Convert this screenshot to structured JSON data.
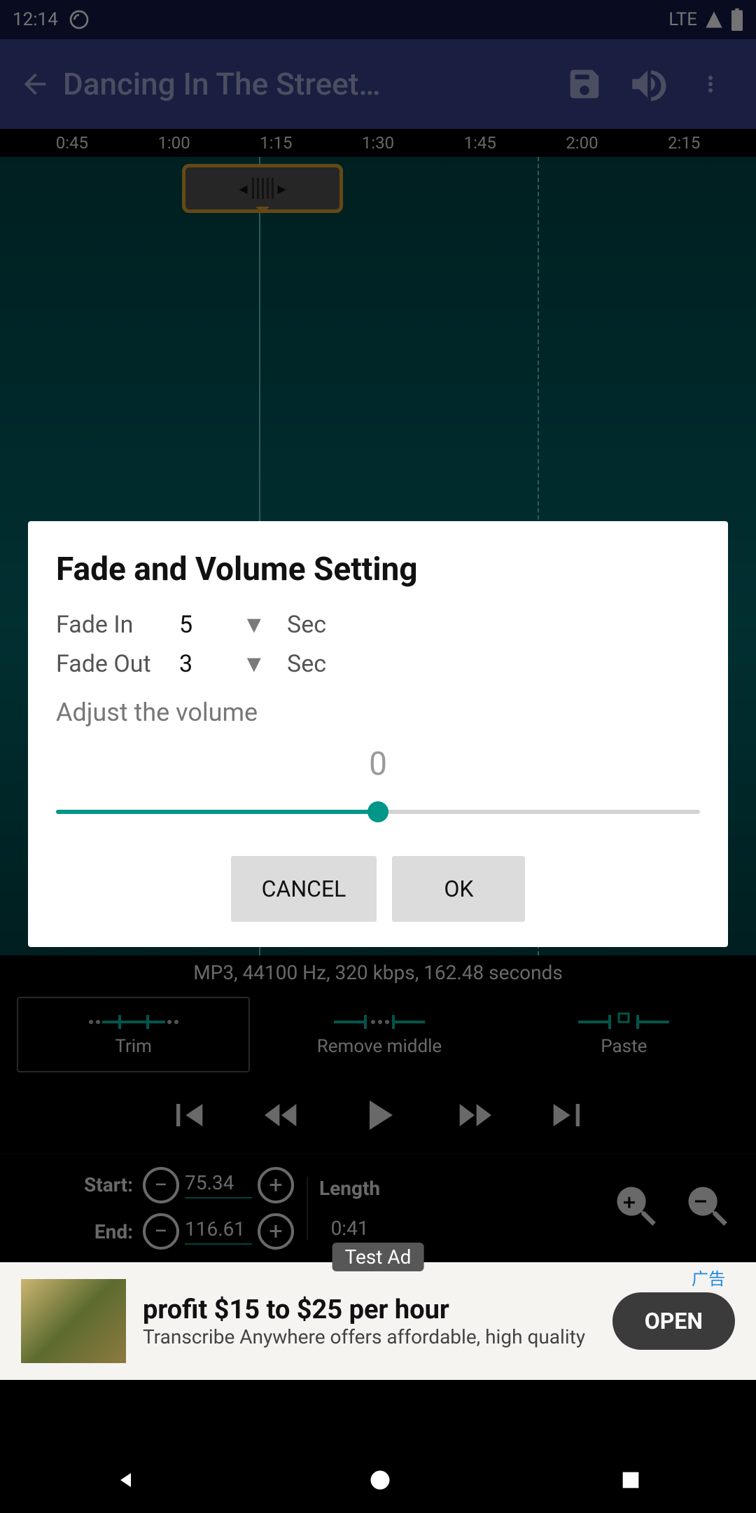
{
  "status_bar": {
    "time": "12:14",
    "network": "LTE"
  },
  "app_bar": {
    "title": "Dancing In The Street…"
  },
  "ruler_ticks": [
    "0:45",
    "1:00",
    "1:15",
    "1:30",
    "1:45",
    "2:00",
    "2:15"
  ],
  "dialog": {
    "title": "Fade and Volume Setting",
    "fade_in_label": "Fade In",
    "fade_in_value": "5",
    "fade_out_label": "Fade Out",
    "fade_out_value": "3",
    "unit": "Sec",
    "adjust_label": "Adjust the volume",
    "volume_value": "0",
    "cancel_label": "CANCEL",
    "ok_label": "OK"
  },
  "file_info": "MP3, 44100 Hz, 320 kbps, 162.48 seconds",
  "modes": {
    "trim": "Trim",
    "remove_middle": "Remove middle",
    "paste": "Paste"
  },
  "params": {
    "start_label": "Start:",
    "start_value": "75.34",
    "end_label": "End:",
    "end_value": "116.61",
    "length_label": "Length",
    "length_value": "0:41"
  },
  "ad": {
    "badge": "Test Ad",
    "headline": "profit $15 to $25 per hour",
    "subline": "Transcribe Anywhere offers affordable, high quality",
    "open_label": "OPEN",
    "tag": "广告"
  }
}
